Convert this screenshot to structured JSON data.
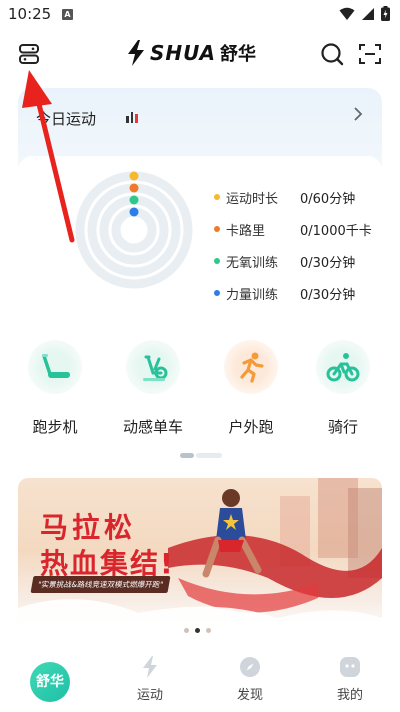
{
  "status_bar": {
    "time": "10:25",
    "app_badge": "A"
  },
  "header": {
    "brand": "SHUA",
    "brand_cn": "舒华"
  },
  "today": {
    "title": "今日运动",
    "metrics": [
      {
        "label": "运动时长",
        "value": "0/60分钟",
        "color": "#f5b92b"
      },
      {
        "label": "卡路里",
        "value": "0/1000千卡",
        "color": "#f07a2a"
      },
      {
        "label": "无氧训练",
        "value": "0/30分钟",
        "color": "#2ec98a"
      },
      {
        "label": "力量训练",
        "value": "0/30分钟",
        "color": "#2b7de8"
      }
    ]
  },
  "sports": [
    {
      "label": "跑步机",
      "icon": "treadmill-icon"
    },
    {
      "label": "动感单车",
      "icon": "spin-bike-icon"
    },
    {
      "label": "户外跑",
      "icon": "outdoor-run-icon"
    },
    {
      "label": "骑行",
      "icon": "cycling-icon"
    }
  ],
  "banner": {
    "title_line1": "马拉松",
    "title_line2": "热血集结!",
    "subtitle": "\"实景挑战&路线竞速双模式燃爆开跑\""
  },
  "bottom_nav": {
    "home": "舒华",
    "items": [
      {
        "label": "运动"
      },
      {
        "label": "发现"
      },
      {
        "label": "我的"
      }
    ]
  },
  "colors": {
    "accent": "#1fbfa6",
    "arrow": "#e8231d",
    "banner_red": "#d8262c"
  }
}
